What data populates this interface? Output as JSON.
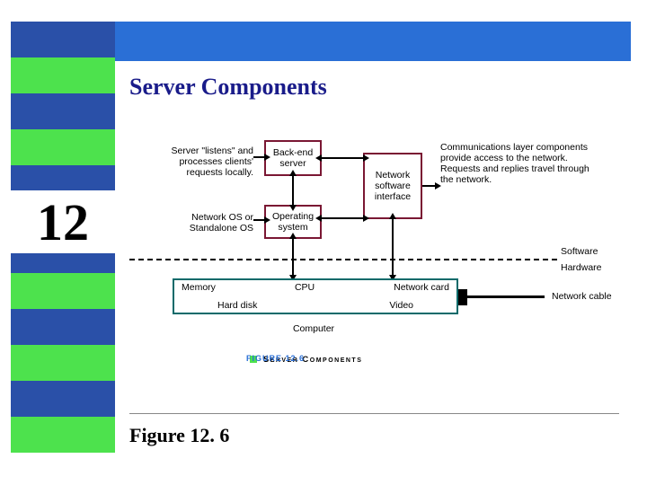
{
  "chapter_number": "12",
  "title": "Server Components",
  "caption_bottom": "Figure 12. 6",
  "figure_label_prefix": "FIGURE 12.6",
  "figure_label_title": "Server Components",
  "annotations": {
    "listen": "Server \"listens\" and processes clients' requests locally.",
    "netos": "Network OS or Standalone OS",
    "comms": "Communications layer components provide access to the network. Requests and replies travel through the network.",
    "sw": "Software",
    "hw": "Hardware",
    "computer": "Computer",
    "cable": "Network cable"
  },
  "boxes": {
    "backend": "Back-end server",
    "os": "Operating system",
    "nsi": "Network software interface"
  },
  "hardware": {
    "row1": [
      "Memory",
      "CPU",
      "Network card"
    ],
    "row2": [
      "Hard disk",
      "Video"
    ]
  }
}
